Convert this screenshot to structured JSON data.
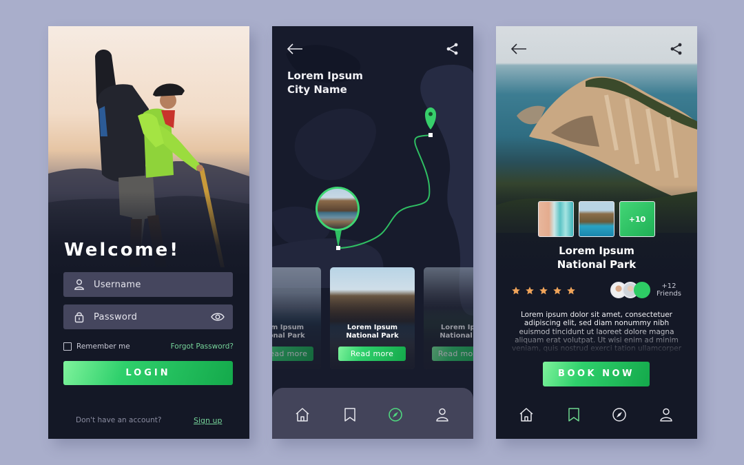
{
  "colors": {
    "background": "#a9aecb",
    "screen_dark": "#141826",
    "accent_green": "#2ecc65",
    "link_green": "#76d49a",
    "field_bg": "#45465e",
    "star": "#f0a45a"
  },
  "login_screen": {
    "welcome": "Welcome!",
    "username": {
      "placeholder": "Username",
      "icon": "user-icon"
    },
    "password": {
      "placeholder": "Password",
      "icon": "lock-icon",
      "toggle_icon": "eye-icon"
    },
    "remember_me": {
      "label": "Remember me",
      "checked": false
    },
    "forgot_password": "Forgot Password?",
    "login_button": "LOGIN",
    "no_account_text": "Don't have an account?",
    "signup_link": "Sign up"
  },
  "map_screen": {
    "back_icon": "arrow-left-icon",
    "share_icon": "share-icon",
    "title_line1": "Lorem Ipsum",
    "title_line2": "City Name",
    "cards": [
      {
        "title_line1": "Lorem Ipsum",
        "title_line2": "National Park",
        "button": "Read more"
      },
      {
        "title_line1": "Lorem Ipsum",
        "title_line2": "National Park",
        "button": "Read more"
      },
      {
        "title_line1": "Lorem Ipsum",
        "title_line2": "National Park",
        "button": "Read more"
      }
    ],
    "nav": [
      {
        "icon": "home-icon",
        "active": false
      },
      {
        "icon": "bookmark-icon",
        "active": false
      },
      {
        "icon": "compass-icon",
        "active": true
      },
      {
        "icon": "user-icon",
        "active": false
      }
    ]
  },
  "detail_screen": {
    "back_icon": "arrow-left-icon",
    "share_icon": "share-icon",
    "more_photos": "+10",
    "title_line1": "Lorem Ipsum",
    "title_line2": "National Park",
    "rating": 5,
    "rating_max": 5,
    "friends_count": "+12",
    "friends_label": "Friends",
    "description": "Lorem ipsum dolor sit amet, consectetuer adipiscing elit, sed diam nonummy nibh euismod tincidunt ut laoreet dolore magna aliquam erat volutpat. Ut wisi enim ad minim veniam, quis nostrud exerci tation ullamcorper suscipit lobortis nisl ut aliquip",
    "book_button": "BOOK NOW",
    "nav": [
      {
        "icon": "home-icon",
        "active": false
      },
      {
        "icon": "bookmark-icon",
        "active": true
      },
      {
        "icon": "compass-icon",
        "active": false
      },
      {
        "icon": "user-icon",
        "active": false
      }
    ]
  }
}
